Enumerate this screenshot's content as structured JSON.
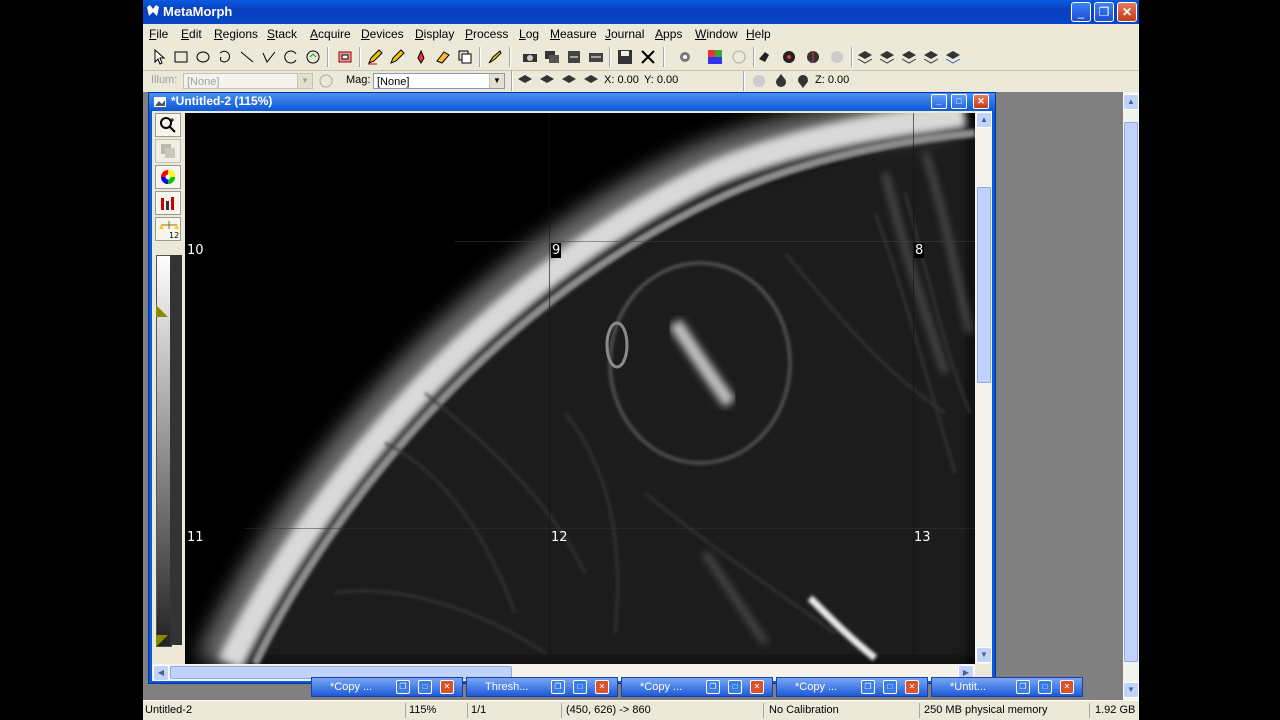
{
  "app": {
    "title": "MetaMorph"
  },
  "menu": [
    "File",
    "Edit",
    "Regions",
    "Stack",
    "Acquire",
    "Devices",
    "Display",
    "Process",
    "Log",
    "Measure",
    "Journal",
    "Apps",
    "Window",
    "Help"
  ],
  "toolbar2": {
    "illum_label": "Illum:",
    "illum_value": "[None]",
    "mag_label": "Mag:",
    "mag_value": "[None]",
    "x_readout": "X: 0.00",
    "y_readout": "Y: 0.00",
    "z_readout": "Z: 0.00"
  },
  "image_window": {
    "title": "*Untitled-2 (115%)",
    "tile_labels": [
      "10",
      "9",
      "8",
      "11",
      "12",
      "13"
    ]
  },
  "minimized_windows": [
    {
      "title": "*Copy ..."
    },
    {
      "title": "Thresh..."
    },
    {
      "title": "*Copy ..."
    },
    {
      "title": "*Copy ..."
    },
    {
      "title": "*Untit..."
    }
  ],
  "status": {
    "name": "Untitled-2",
    "zoom": "115%",
    "frame": "1/1",
    "coords": "(450, 626) -> 860",
    "calibration": "No Calibration",
    "physical_memory": "250 MB physical memory",
    "disk": "1.92 GB"
  },
  "colors": {
    "titlebar": "#0a5ae0",
    "chrome": "#ece9d8",
    "close": "#c33d18"
  }
}
